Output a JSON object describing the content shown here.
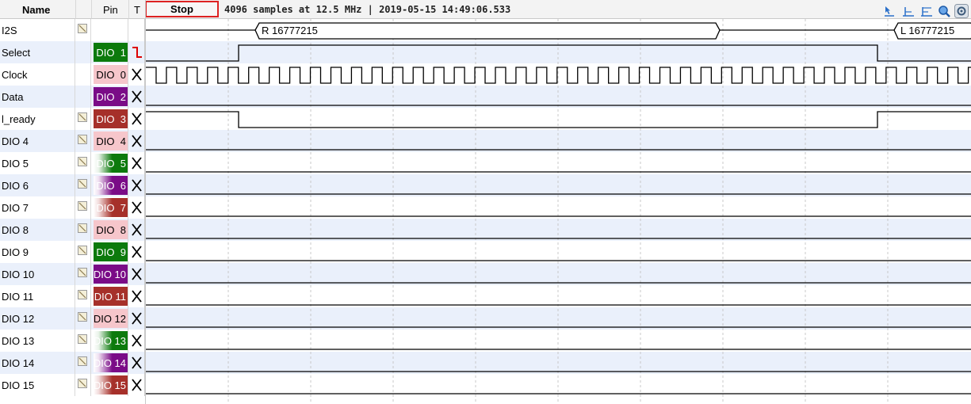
{
  "header": {
    "name_label": "Name",
    "pin_label": "Pin",
    "t_label": "T",
    "stop_label": "Stop",
    "status": "4096 samples at 12.5 MHz | 2019-05-15 14:49:06.533"
  },
  "toolbar": {
    "icons": [
      "select-cursor-icon",
      "timestamp-icon",
      "measure-icon",
      "zoom-icon",
      "settings-icon"
    ]
  },
  "channels": [
    {
      "name": "I2S",
      "pin": "",
      "editable": true,
      "trigger": "none",
      "kind": "decoder"
    },
    {
      "name": "Select",
      "pin": "DIO  1",
      "editable": false,
      "trigger": "falling",
      "kind": "digital",
      "pin_style": "green"
    },
    {
      "name": "Clock",
      "pin": "DIO  0",
      "editable": false,
      "trigger": "x",
      "kind": "clock",
      "pin_style": "pink"
    },
    {
      "name": "Data",
      "pin": "DIO  2",
      "editable": false,
      "trigger": "x",
      "kind": "low",
      "pin_style": "purple"
    },
    {
      "name": "l_ready",
      "pin": "DIO  3",
      "editable": true,
      "trigger": "x",
      "kind": "digital",
      "pin_style": "darkred"
    },
    {
      "name": "DIO 4",
      "pin": "DIO  4",
      "editable": true,
      "trigger": "x",
      "kind": "low",
      "pin_style": "pink"
    },
    {
      "name": "DIO 5",
      "pin": "DIO  5",
      "editable": true,
      "trigger": "x",
      "kind": "low",
      "pin_style": "fade-green"
    },
    {
      "name": "DIO 6",
      "pin": "DIO  6",
      "editable": true,
      "trigger": "x",
      "kind": "low",
      "pin_style": "fade-purple"
    },
    {
      "name": "DIO 7",
      "pin": "DIO  7",
      "editable": true,
      "trigger": "x",
      "kind": "low",
      "pin_style": "fade-red"
    },
    {
      "name": "DIO 8",
      "pin": "DIO  8",
      "editable": true,
      "trigger": "x",
      "kind": "low",
      "pin_style": "pink"
    },
    {
      "name": "DIO 9",
      "pin": "DIO  9",
      "editable": true,
      "trigger": "x",
      "kind": "low",
      "pin_style": "green"
    },
    {
      "name": "DIO 10",
      "pin": "DIO 10",
      "editable": true,
      "trigger": "x",
      "kind": "low",
      "pin_style": "purple"
    },
    {
      "name": "DIO 11",
      "pin": "DIO 11",
      "editable": true,
      "trigger": "x",
      "kind": "low",
      "pin_style": "darkred"
    },
    {
      "name": "DIO 12",
      "pin": "DIO 12",
      "editable": true,
      "trigger": "x",
      "kind": "low",
      "pin_style": "pink"
    },
    {
      "name": "DIO 13",
      "pin": "DIO 13",
      "editable": true,
      "trigger": "x",
      "kind": "low",
      "pin_style": "fade-green"
    },
    {
      "name": "DIO 14",
      "pin": "DIO 14",
      "editable": true,
      "trigger": "x",
      "kind": "low",
      "pin_style": "fade-purple"
    },
    {
      "name": "DIO 15",
      "pin": "DIO 15",
      "editable": true,
      "trigger": "x",
      "kind": "low",
      "pin_style": "fade-red"
    }
  ],
  "decoder": {
    "segments": [
      {
        "label": "R 16777215"
      },
      {
        "label": "L 16777215"
      }
    ]
  },
  "colors": {
    "row_alt": "#eaf0fb",
    "trace": "#000000",
    "grid": "#c8c8c8",
    "stop_border": "#dd2222",
    "trigger_red": "#dd0000"
  }
}
